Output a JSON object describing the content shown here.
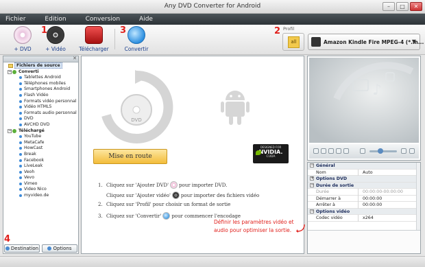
{
  "window": {
    "title": "Any DVD Converter for Android"
  },
  "menu": [
    "Fichier",
    "Edition",
    "Conversion",
    "Aide"
  ],
  "toolbar": {
    "add_dvd": "+ DVD",
    "add_video": "+ Vidéo",
    "download": "Télécharger",
    "convert": "Convertir",
    "profile_label": "Profil",
    "profile_icon_text": "all",
    "profile_value": "Amazon Kindle Fire MPEG-4 (*.m...",
    "steps": {
      "s1": "1",
      "s2": "2",
      "s3": "3",
      "s4": "4"
    }
  },
  "sidebar": {
    "root": "Fichiers de source",
    "groups": [
      {
        "label": "Converti",
        "items": [
          "Tablettes Android",
          "Téléphones mobiles",
          "Smartphones Android",
          "Flash Vidéo",
          "Formats vidéo personnal",
          "Vidéo HTML5",
          "Formats audio personnal",
          "DVD",
          "AVCHD DVD"
        ]
      },
      {
        "label": "Téléchargé",
        "items": [
          "YouTube",
          "MetaCafe",
          "HowCast",
          "Break",
          "Facebook",
          "LiveLeak",
          "Veoh",
          "Vevo",
          "Vimeo",
          "Video Nico",
          "myvideo.de"
        ]
      }
    ],
    "footer": {
      "destination": "Destination",
      "options": "Options"
    }
  },
  "main": {
    "disc_label": "DVD",
    "start_button": "Mise en route",
    "nvidia": {
      "top": "DESIGNED FOR",
      "brand": "NVIDIA.",
      "bottom": "CUDA"
    },
    "instructions": {
      "n1": "1.",
      "i1a": "Cliquez sur 'Ajouter DVD'",
      "i1b": "pour importer DVD.",
      "i1c": "Cliquez sur 'Ajouter vidéo'",
      "i1d": "pour importer des fichiers vidéo",
      "n2": "2.",
      "i2": "Cliquez sur 'Profil' pour choisir un format de sortie",
      "n3": "3.",
      "i3a": "Cliquez sur 'Convertir'",
      "i3b": "pour commencer l'encodage"
    }
  },
  "properties": {
    "general_header": "Général",
    "name_key": "Nom",
    "name_val": "Auto",
    "dvd_header": "Options DVD",
    "duration_header": "Durée de sortie",
    "duree_key": "Durée",
    "duree_val": "00:00:00-00:00:00",
    "start_key": "Démarrer à",
    "start_val": "00:00:00",
    "stop_key": "Arrêter à",
    "stop_val": "00:00:00",
    "video_header": "Options vidéo",
    "codec_key": "Codec vidéo",
    "codec_val": "x264"
  },
  "annotation": {
    "line1": "Définir les paramètres vidéo et",
    "line2": "audio pour optimiser la sortie."
  },
  "colors": {
    "menubar": "#3a4246",
    "accent_red": "#e0201c",
    "link_blue": "#1a3e8c",
    "start_button": "#f3bd3a"
  },
  "icons": [
    "dvd-add-icon",
    "film-reel-icon",
    "download-icon",
    "convert-icon",
    "profile-all-icon",
    "kindle-device-icon",
    "android-icon",
    "music-note-icon",
    "film-icon"
  ]
}
